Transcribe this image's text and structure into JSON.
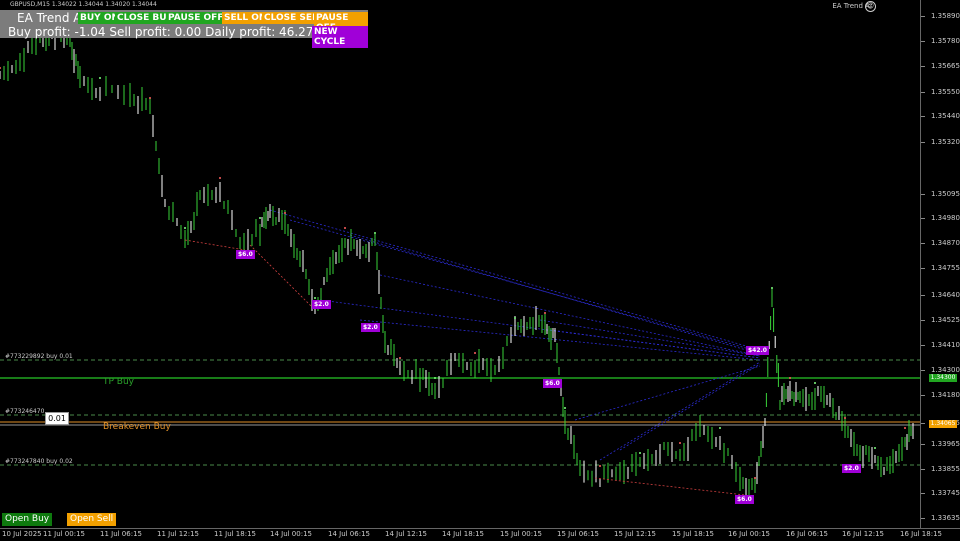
{
  "header": {
    "symbol_info": "GBPUSD,M15  1.34022 1.34044 1.34020 1.34044",
    "ea_name": "EA Trend AI",
    "smiley": "☺"
  },
  "panel": {
    "title": "EA Trend A",
    "buy_button": "BUY ON",
    "close_buy_button": "CLOSE BUY",
    "pause_buy_button": "PAUSE OFF",
    "sell_button": "SELL ON",
    "close_sell_button": "CLOSE SELL",
    "pause_sell_button": "PAUSE OFF",
    "profits_text": "Buy profit: -1.04  Sell profit: 0.00    Daily profit: 46.27",
    "new_cycle_button": "NEW CYCLE"
  },
  "price_scale": [
    "1.35890",
    "1.35780",
    "1.35665",
    "1.35550",
    "1.35440",
    "1.35320",
    "1.35095",
    "1.34980",
    "1.34870",
    "1.34755",
    "1.34640",
    "1.34525",
    "1.34410",
    "1.34300",
    "1.34180",
    "1.34065",
    "1.33965",
    "1.33855",
    "1.33745",
    "1.33635"
  ],
  "time_axis": [
    "10 Jul 2025",
    "11 Jul 00:15",
    "11 Jul 06:15",
    "11 Jul 12:15",
    "11 Jul 18:15",
    "14 Jul 00:15",
    "14 Jul 06:15",
    "14 Jul 12:15",
    "14 Jul 18:15",
    "15 Jul 00:15",
    "15 Jul 06:15",
    "15 Jul 12:15",
    "15 Jul 18:15",
    "16 Jul 00:15",
    "16 Jul 06:15",
    "16 Jul 12:15",
    "16 Jul 18:15",
    "17 Jul 00:15",
    "17 Jul 06:15",
    "17 Jul 12:15"
  ],
  "lines": {
    "order1": "#773229892 buy 0.01",
    "tp": "TP Buy",
    "tp_price": "1.34300",
    "order2": "#773246470",
    "order2_bubble": "0.01",
    "breakeven": "Breakeven Buy",
    "breakeven_price": "1.34065",
    "order3": "#773247840 buy 0.02"
  },
  "tags": [
    "$6.0",
    "$2.0",
    "$2.0",
    "$6.0",
    "$42.0",
    "$6.0",
    "$2.0"
  ],
  "bottom": {
    "open_buy": "Open Buy",
    "open_sell": "Open Sell"
  },
  "colors": {
    "candle_up": "#39d239",
    "buy_line": "#21a621",
    "breakeven_line": "#e0912a",
    "tag_bg": "#a000d8",
    "sell_dots": "#ff6060",
    "buy_dots": "#7fff7f"
  }
}
